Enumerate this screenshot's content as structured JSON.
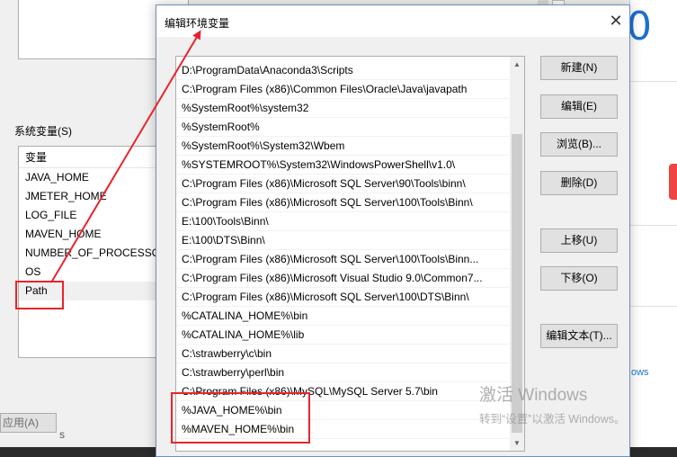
{
  "background_window": {
    "group_label": "系统变量(S)",
    "list_header": "变量",
    "variables": [
      "JAVA_HOME",
      "JMETER_HOME",
      "LOG_FILE",
      "MAVEN_HOME",
      "NUMBER_OF_PROCESSORS",
      "OS",
      "Path"
    ],
    "apply_button": "应用(A)",
    "partial_text": "s"
  },
  "right_window": {
    "partial_number": "0",
    "partial_link": "ows"
  },
  "dialog": {
    "title": "编辑环境变量",
    "close_glyph": "✕",
    "paths": [
      "D:\\ProgramData\\Anaconda3\\Scripts",
      "C:\\Program Files (x86)\\Common Files\\Oracle\\Java\\javapath",
      "%SystemRoot%\\system32",
      "%SystemRoot%",
      "%SystemRoot%\\System32\\Wbem",
      "%SYSTEMROOT%\\System32\\WindowsPowerShell\\v1.0\\",
      "C:\\Program Files (x86)\\Microsoft SQL Server\\90\\Tools\\binn\\",
      "C:\\Program Files (x86)\\Microsoft SQL Server\\100\\Tools\\Binn\\",
      "E:\\100\\Tools\\Binn\\",
      "E:\\100\\DTS\\Binn\\",
      "C:\\Program Files (x86)\\Microsoft SQL Server\\100\\Tools\\Binn...",
      "C:\\Program Files (x86)\\Microsoft Visual Studio 9.0\\Common7...",
      "C:\\Program Files (x86)\\Microsoft SQL Server\\100\\DTS\\Binn\\",
      "%CATALINA_HOME%\\bin",
      "%CATALINA_HOME%\\lib",
      "C:\\strawberry\\c\\bin",
      "C:\\strawberry\\perl\\bin",
      "C:\\Program Files (x86)\\MySQL\\MySQL Server 5.7\\bin",
      "%JAVA_HOME%\\bin",
      "%MAVEN_HOME%\\bin"
    ],
    "buttons": {
      "new": "新建(N)",
      "edit": "编辑(E)",
      "browse": "浏览(B)...",
      "delete": "删除(D)",
      "move_up": "上移(U)",
      "move_down": "下移(O)",
      "edit_text": "编辑文本(T)..."
    }
  },
  "watermark": {
    "line1": "激活 Windows",
    "line2": "转到“设置”以激活 Windows。"
  },
  "annotation_color": "#e8242b"
}
